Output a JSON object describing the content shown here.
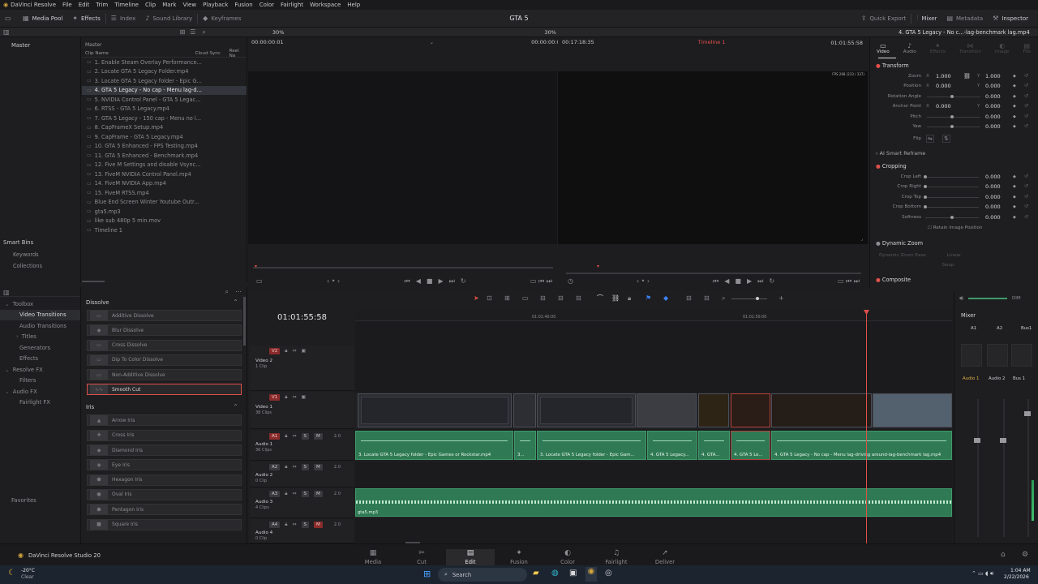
{
  "app": {
    "name": "DaVinci Resolve",
    "project": "GTA 5",
    "version_label": "DaVinci Resolve Studio 20"
  },
  "menu": [
    "DaVinci Resolve",
    "File",
    "Edit",
    "Trim",
    "Timeline",
    "Clip",
    "Mark",
    "View",
    "Playback",
    "Fusion",
    "Color",
    "Fairlight",
    "Workspace",
    "Help"
  ],
  "toolbar": {
    "left": [
      "Media Pool",
      "Effects",
      "Index",
      "Sound Library",
      "Keyframes"
    ],
    "right": [
      "Quick Export",
      "Mixer",
      "Metadata",
      "Inspector"
    ]
  },
  "media_pool": {
    "bin": "Master",
    "header": "Master",
    "columns": [
      "Clip Name",
      "Cloud Sync",
      "Reel Na"
    ],
    "clips": [
      "1. Enable Steam Overlay Performance...",
      "2. Locate GTA 5 Legacy Folder.mp4",
      "3. Locate GTA 5 Legacy folder - Epic G...",
      "4. GTA 5 Legacy - No cap - Menu lag-d...",
      "5. NVIDIA Control Panel - GTA 5 Legac...",
      "6. RTSS - GTA 5 Legacy.mp4",
      "7. GTA 5 Legacy - 150 cap - Menu no l...",
      "8. CapFrameX Setup.mp4",
      "9. CapFrame - GTA 5 Legacy.mp4",
      "10. GTA 5 Enhanced - FPS Testing.mp4",
      "11. GTA 5 Enhanced - Benchmark.mp4",
      "12. Five M Settings and disable Vsync...",
      "13. FiveM NVIDIA Control Panel.mp4",
      "14. FiveM NVIDIA App.mp4",
      "15. FiveM RTSS.mp4",
      "Blue End Screen Winter Youtube Outr...",
      "gta5.mp3",
      "like sub 480p 5 min.mov",
      "Timeline 1"
    ],
    "selected_index": 3,
    "smart_bins": "Smart Bins",
    "smart_items": [
      "Keywords",
      "Collections"
    ]
  },
  "viewer": {
    "source_zoom": "30%",
    "source_tc_left": "00:00:00:01",
    "source_tc_right": "00:00:00:00",
    "timeline_zoom": "30%",
    "timeline_duration": "00:17:18:35",
    "timeline_name": "Timeline 1",
    "timeline_tc": "01:01:55:58",
    "fps_overlay": "FPS 268 (233 / 337)"
  },
  "toolbox": {
    "items": [
      {
        "label": "Toolbox",
        "level": 0
      },
      {
        "label": "Video Transitions",
        "level": 1,
        "selected": true
      },
      {
        "label": "Audio Transitions",
        "level": 1
      },
      {
        "label": "Titles",
        "level": 1
      },
      {
        "label": "Generators",
        "level": 1
      },
      {
        "label": "Effects",
        "level": 1
      },
      {
        "label": "Resolve FX",
        "level": 0
      },
      {
        "label": "Filters",
        "level": 1
      },
      {
        "label": "Audio FX",
        "level": 0
      },
      {
        "label": "Fairlight FX",
        "level": 1
      }
    ],
    "favorites": "Favorites"
  },
  "effects": {
    "dissolve_header": "Dissolve",
    "dissolve": [
      "Additive Dissolve",
      "Blur Dissolve",
      "Cross Dissolve",
      "Dip To Color Dissolve",
      "Non-Additive Dissolve",
      "Smooth Cut"
    ],
    "iris_header": "Iris",
    "iris": [
      "Arrow Iris",
      "Cross Iris",
      "Diamond Iris",
      "Eye Iris",
      "Hexagon Iris",
      "Oval Iris",
      "Pentagon Iris",
      "Square Iris"
    ]
  },
  "timeline": {
    "timecode": "01:01:55:58",
    "ruler": [
      "01:01:40:00",
      "01:01:50:00"
    ],
    "tracks": [
      {
        "id": "V2",
        "name": "Video 2",
        "clips": "1 Clip"
      },
      {
        "id": "V1",
        "name": "Video 1",
        "clips": "38 Clips"
      },
      {
        "id": "A1",
        "name": "Audio 1",
        "clips": "36 Clips",
        "level": "2.0"
      },
      {
        "id": "A2",
        "name": "Audio 2",
        "clips": "0 Clip",
        "level": "2.0"
      },
      {
        "id": "A3",
        "name": "Audio 3",
        "clips": "4 Clips",
        "level": "2.0"
      },
      {
        "id": "A4",
        "name": "Audio 4",
        "clips": "0 Clip",
        "level": "2.0"
      }
    ],
    "audio_clip_labels": [
      "3. Locate GTA 5 Legacy folder - Epic Games or Rockstar.mp4",
      "3...",
      "3. Locate GTA 5 Legacy folder - Epic Gam...",
      "4. GTA 5 Legacy...",
      "4. GTA...",
      "4. GTA 5 Le...",
      "4. GTA 5 Legacy - No cap - Menu lag-driving around-lag-benchmark lag.mp4"
    ],
    "audio3_label": "gta5.mp3"
  },
  "inspector": {
    "clip_title": "4. GTA 5 Legacy - No c...-lag-benchmark lag.mp4",
    "tabs": [
      "Video",
      "Audio",
      "Effects",
      "Transition",
      "Image",
      "File"
    ],
    "transform": "Transform",
    "zoom_label": "Zoom",
    "zoom_x": "1.000",
    "zoom_y": "1.000",
    "position_label": "Position",
    "pos_x": "0.000",
    "pos_y": "0.000",
    "rotation_label": "Rotation Angle",
    "rotation": "0.000",
    "anchor_label": "Anchor Point",
    "anchor_x": "0.000",
    "anchor_y": "0.000",
    "pitch_label": "Pitch",
    "pitch": "0.000",
    "yaw_label": "Yaw",
    "yaw": "0.000",
    "flip_label": "Flip",
    "smart_reframe": "AI Smart Reframe",
    "cropping": "Cropping",
    "crop_left_label": "Crop Left",
    "crop_left": "0.000",
    "crop_right_label": "Crop Right",
    "crop_right": "0.000",
    "crop_top_label": "Crop Top",
    "crop_top": "0.000",
    "crop_bottom_label": "Crop Bottom",
    "crop_bottom": "0.000",
    "softness_label": "Softness",
    "softness": "0.000",
    "retain": "Retain Image Position",
    "dynamic_zoom": "Dynamic Zoom",
    "dz_ease": "Dynamic Zoom Ease",
    "dz_ease_val": "Linear",
    "dz_swap": "Swap",
    "composite": "Composite"
  },
  "mixer": {
    "title": "Mixer",
    "channels": [
      "A1",
      "A2",
      "Bus1"
    ],
    "strips": [
      "Audio 1",
      "Audio 2",
      "Bus 1"
    ],
    "dim": "DIM"
  },
  "pages": [
    "Media",
    "Cut",
    "Edit",
    "Fusion",
    "Color",
    "Fairlight",
    "Deliver"
  ],
  "active_page": "Edit",
  "taskbar": {
    "weather_temp": "-20°C",
    "weather_desc": "Clear",
    "search": "Search",
    "time": "1:04 AM",
    "date": "2/22/2026"
  },
  "colors": {
    "accent_red": "#e0504a",
    "audio_green": "#2f7a54",
    "playhead": "#e0504a"
  }
}
